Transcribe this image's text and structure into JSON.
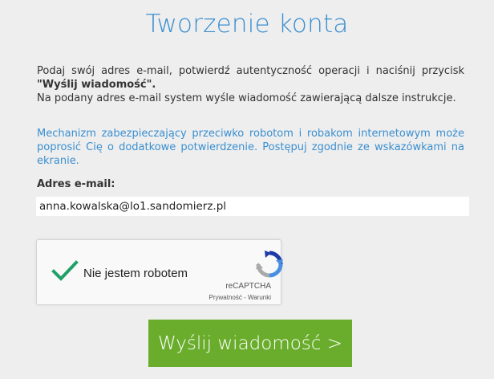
{
  "page": {
    "title": "Tworzenie konta"
  },
  "instructions": {
    "line1_start": "Podaj swój adres e-mail, potwierdź autentyczność operacji i naciśnij przycisk ",
    "button_ref": "\"Wyślij wiadomość\".",
    "line2": "Na podany adres e-mail system wyśle wiadomość zawierającą dalsze instrukcje.",
    "robot_notice": "Mechanizm zabezpieczający przeciwko robotom i robakom internetowym może poprosić Cię o dodatkowe potwierdzenie. Postępuj zgodnie ze wskazówkami na ekranie."
  },
  "form": {
    "email_label": "Adres e-mail:",
    "email_value": "anna.kowalska@lo1.sandomierz.pl",
    "submit_label": "Wyślij wiadomość >"
  },
  "captcha": {
    "checked": true,
    "label": "Nie jestem robotem",
    "brand": "reCAPTCHA",
    "links": "Prywatność - Warunki",
    "check_color": "#1fa067"
  },
  "colors": {
    "accent_blue": "#3a8fd0",
    "submit_green": "#6aad2c",
    "background": "#eeeeee"
  }
}
